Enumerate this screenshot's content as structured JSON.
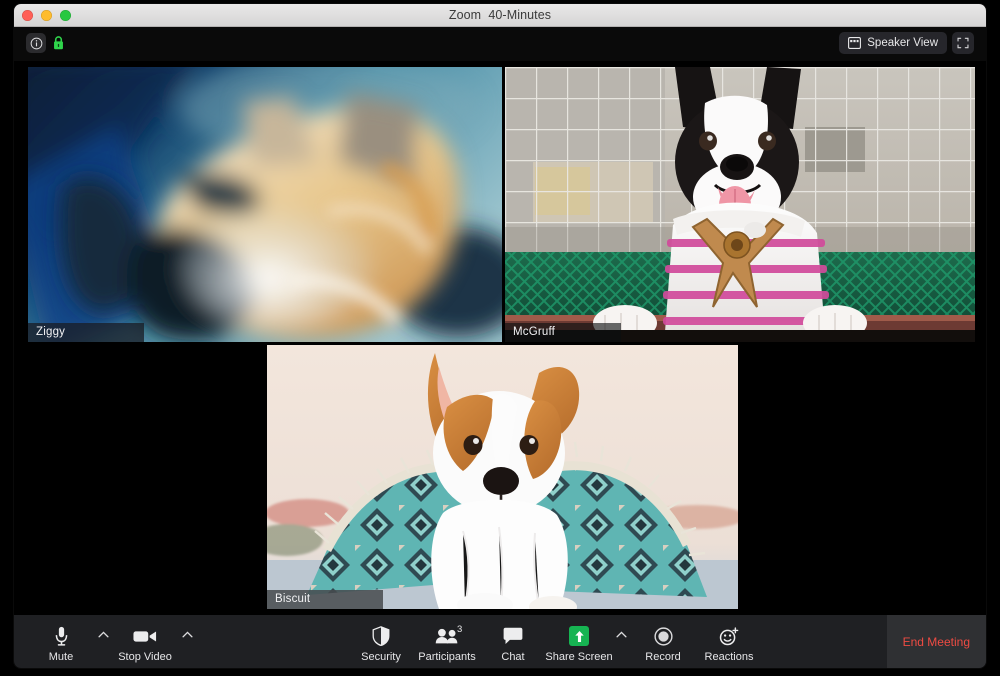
{
  "window": {
    "title": "Zoom  40-Minutes",
    "traffic_lights": [
      {
        "name": "close",
        "color": "#ff5f57"
      },
      {
        "name": "minimize",
        "color": "#febc2e"
      },
      {
        "name": "maximize",
        "color": "#28c840"
      }
    ]
  },
  "topbar": {
    "info_icon": "info-icon",
    "encryption_icon": "green-lock-icon",
    "view_button_label": "Speaker View",
    "view_button_icon": "grid-view-icon",
    "fullscreen_icon": "fullscreen-expand-icon"
  },
  "stage": {
    "active_speaker_border_color": "#d9e94f",
    "tiles": [
      {
        "name": "Ziggy",
        "active_speaker": true,
        "badge_style": "dark-navy",
        "description": "motion-blurred small cream and tan dog against teal blue background"
      },
      {
        "name": "McGruff",
        "active_speaker": false,
        "badge_style": "transparent-dark",
        "description": "boston terrier in pink striped shirt with tan harness at a railing"
      },
      {
        "name": "Biscuit",
        "active_speaker": false,
        "badge_style": "grey",
        "description": "white and tan jack russell under a teal patterned fringed blanket"
      }
    ]
  },
  "toolbar": {
    "left": [
      {
        "label": "Mute",
        "icon": "microphone-icon",
        "has_chevron": true
      },
      {
        "label": "Stop Video",
        "icon": "video-camera-icon",
        "has_chevron": true
      }
    ],
    "center": [
      {
        "label": "Security",
        "icon": "shield-icon",
        "has_chevron": false,
        "badge": ""
      },
      {
        "label": "Participants",
        "icon": "people-icon",
        "has_chevron": false,
        "badge": "3"
      },
      {
        "label": "Chat",
        "icon": "chat-bubble-icon",
        "has_chevron": false,
        "badge": ""
      },
      {
        "label": "Share Screen",
        "icon": "share-screen-icon",
        "has_chevron": true,
        "badge": ""
      },
      {
        "label": "Record",
        "icon": "record-circle-icon",
        "has_chevron": false,
        "badge": ""
      },
      {
        "label": "Reactions",
        "icon": "reactions-smiley-icon",
        "has_chevron": false,
        "badge": ""
      }
    ],
    "end_meeting_label": "End Meeting",
    "end_meeting_color": "#ee4b43",
    "share_screen_accent": "#16b452"
  }
}
